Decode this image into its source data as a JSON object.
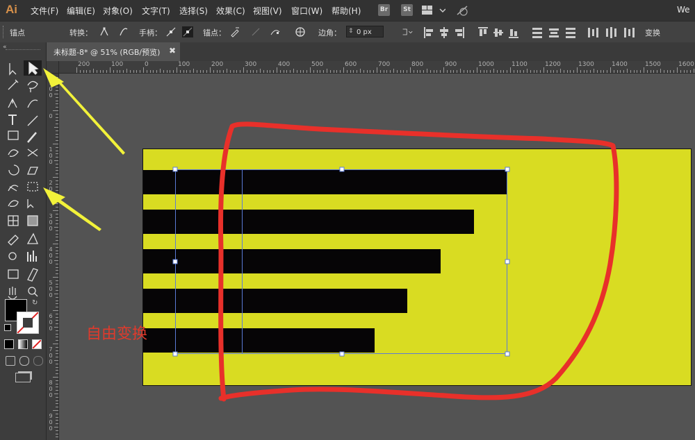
{
  "menubar": {
    "app_logo": "Ai",
    "menus": [
      "文件(F)",
      "编辑(E)",
      "对象(O)",
      "文字(T)",
      "选择(S)",
      "效果(C)",
      "视图(V)",
      "窗口(W)",
      "帮助(H)"
    ],
    "bridge_badge": "Br",
    "stock_badge": "St",
    "right_text": "We"
  },
  "controlbar": {
    "anchor_label": "锚点",
    "convert_label": "转换：",
    "handle_label": "手柄：",
    "anchor2_label": "锚点：",
    "corner_label": "边角：",
    "corner_value": "0 px",
    "transform_label": "变换"
  },
  "document": {
    "tab_title": "未标题-8* @ 51% (RGB/预览)"
  },
  "ruler": {
    "h_labels": [
      "200",
      "100",
      "0",
      "100",
      "200",
      "300",
      "400",
      "500",
      "600",
      "700",
      "800",
      "900",
      "1000",
      "1100",
      "1200",
      "1300",
      "1400",
      "1500",
      "1600"
    ],
    "v_labels": [
      "1\n0\n0",
      "0",
      "1\n0\n0",
      "2\n0\n0",
      "3\n0\n0",
      "4\n0\n0",
      "5\n0\n0",
      "6\n0\n0",
      "7\n0\n0",
      "8\n0\n0",
      "9\n0\n0"
    ]
  },
  "annotation": {
    "text": "自由变换",
    "color": "#e03a2c"
  },
  "colors": {
    "artboard_fill": "#d9dc22",
    "bar_fill": "#060506",
    "selection": "#5b7bd6",
    "arrow": "#f2f23a",
    "scribble": "#e8302a"
  },
  "tools": [
    "direct-selection",
    "selection",
    "magic-wand",
    "lasso",
    "pen",
    "curvature",
    "type",
    "line",
    "rectangle",
    "paintbrush",
    "shaper",
    "scissors",
    "rotate",
    "width",
    "puppet-warp",
    "free-transform",
    "shape-builder",
    "live-paint-selection",
    "mesh",
    "gradient",
    "eyedropper",
    "blend",
    "symbol-sprayer",
    "column-graph",
    "artboard",
    "slice",
    "hand",
    "zoom"
  ]
}
